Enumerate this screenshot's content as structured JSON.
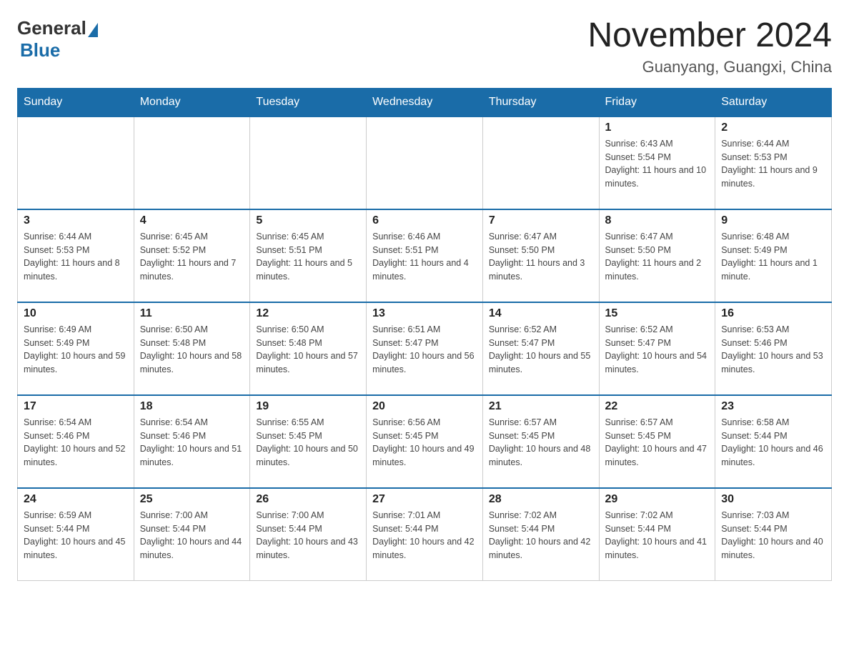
{
  "header": {
    "logo_general": "General",
    "logo_blue": "Blue",
    "title": "November 2024",
    "subtitle": "Guanyang, Guangxi, China"
  },
  "days_of_week": [
    "Sunday",
    "Monday",
    "Tuesday",
    "Wednesday",
    "Thursday",
    "Friday",
    "Saturday"
  ],
  "weeks": [
    [
      {
        "day": "",
        "info": ""
      },
      {
        "day": "",
        "info": ""
      },
      {
        "day": "",
        "info": ""
      },
      {
        "day": "",
        "info": ""
      },
      {
        "day": "",
        "info": ""
      },
      {
        "day": "1",
        "info": "Sunrise: 6:43 AM\nSunset: 5:54 PM\nDaylight: 11 hours and 10 minutes."
      },
      {
        "day": "2",
        "info": "Sunrise: 6:44 AM\nSunset: 5:53 PM\nDaylight: 11 hours and 9 minutes."
      }
    ],
    [
      {
        "day": "3",
        "info": "Sunrise: 6:44 AM\nSunset: 5:53 PM\nDaylight: 11 hours and 8 minutes."
      },
      {
        "day": "4",
        "info": "Sunrise: 6:45 AM\nSunset: 5:52 PM\nDaylight: 11 hours and 7 minutes."
      },
      {
        "day": "5",
        "info": "Sunrise: 6:45 AM\nSunset: 5:51 PM\nDaylight: 11 hours and 5 minutes."
      },
      {
        "day": "6",
        "info": "Sunrise: 6:46 AM\nSunset: 5:51 PM\nDaylight: 11 hours and 4 minutes."
      },
      {
        "day": "7",
        "info": "Sunrise: 6:47 AM\nSunset: 5:50 PM\nDaylight: 11 hours and 3 minutes."
      },
      {
        "day": "8",
        "info": "Sunrise: 6:47 AM\nSunset: 5:50 PM\nDaylight: 11 hours and 2 minutes."
      },
      {
        "day": "9",
        "info": "Sunrise: 6:48 AM\nSunset: 5:49 PM\nDaylight: 11 hours and 1 minute."
      }
    ],
    [
      {
        "day": "10",
        "info": "Sunrise: 6:49 AM\nSunset: 5:49 PM\nDaylight: 10 hours and 59 minutes."
      },
      {
        "day": "11",
        "info": "Sunrise: 6:50 AM\nSunset: 5:48 PM\nDaylight: 10 hours and 58 minutes."
      },
      {
        "day": "12",
        "info": "Sunrise: 6:50 AM\nSunset: 5:48 PM\nDaylight: 10 hours and 57 minutes."
      },
      {
        "day": "13",
        "info": "Sunrise: 6:51 AM\nSunset: 5:47 PM\nDaylight: 10 hours and 56 minutes."
      },
      {
        "day": "14",
        "info": "Sunrise: 6:52 AM\nSunset: 5:47 PM\nDaylight: 10 hours and 55 minutes."
      },
      {
        "day": "15",
        "info": "Sunrise: 6:52 AM\nSunset: 5:47 PM\nDaylight: 10 hours and 54 minutes."
      },
      {
        "day": "16",
        "info": "Sunrise: 6:53 AM\nSunset: 5:46 PM\nDaylight: 10 hours and 53 minutes."
      }
    ],
    [
      {
        "day": "17",
        "info": "Sunrise: 6:54 AM\nSunset: 5:46 PM\nDaylight: 10 hours and 52 minutes."
      },
      {
        "day": "18",
        "info": "Sunrise: 6:54 AM\nSunset: 5:46 PM\nDaylight: 10 hours and 51 minutes."
      },
      {
        "day": "19",
        "info": "Sunrise: 6:55 AM\nSunset: 5:45 PM\nDaylight: 10 hours and 50 minutes."
      },
      {
        "day": "20",
        "info": "Sunrise: 6:56 AM\nSunset: 5:45 PM\nDaylight: 10 hours and 49 minutes."
      },
      {
        "day": "21",
        "info": "Sunrise: 6:57 AM\nSunset: 5:45 PM\nDaylight: 10 hours and 48 minutes."
      },
      {
        "day": "22",
        "info": "Sunrise: 6:57 AM\nSunset: 5:45 PM\nDaylight: 10 hours and 47 minutes."
      },
      {
        "day": "23",
        "info": "Sunrise: 6:58 AM\nSunset: 5:44 PM\nDaylight: 10 hours and 46 minutes."
      }
    ],
    [
      {
        "day": "24",
        "info": "Sunrise: 6:59 AM\nSunset: 5:44 PM\nDaylight: 10 hours and 45 minutes."
      },
      {
        "day": "25",
        "info": "Sunrise: 7:00 AM\nSunset: 5:44 PM\nDaylight: 10 hours and 44 minutes."
      },
      {
        "day": "26",
        "info": "Sunrise: 7:00 AM\nSunset: 5:44 PM\nDaylight: 10 hours and 43 minutes."
      },
      {
        "day": "27",
        "info": "Sunrise: 7:01 AM\nSunset: 5:44 PM\nDaylight: 10 hours and 42 minutes."
      },
      {
        "day": "28",
        "info": "Sunrise: 7:02 AM\nSunset: 5:44 PM\nDaylight: 10 hours and 42 minutes."
      },
      {
        "day": "29",
        "info": "Sunrise: 7:02 AM\nSunset: 5:44 PM\nDaylight: 10 hours and 41 minutes."
      },
      {
        "day": "30",
        "info": "Sunrise: 7:03 AM\nSunset: 5:44 PM\nDaylight: 10 hours and 40 minutes."
      }
    ]
  ]
}
